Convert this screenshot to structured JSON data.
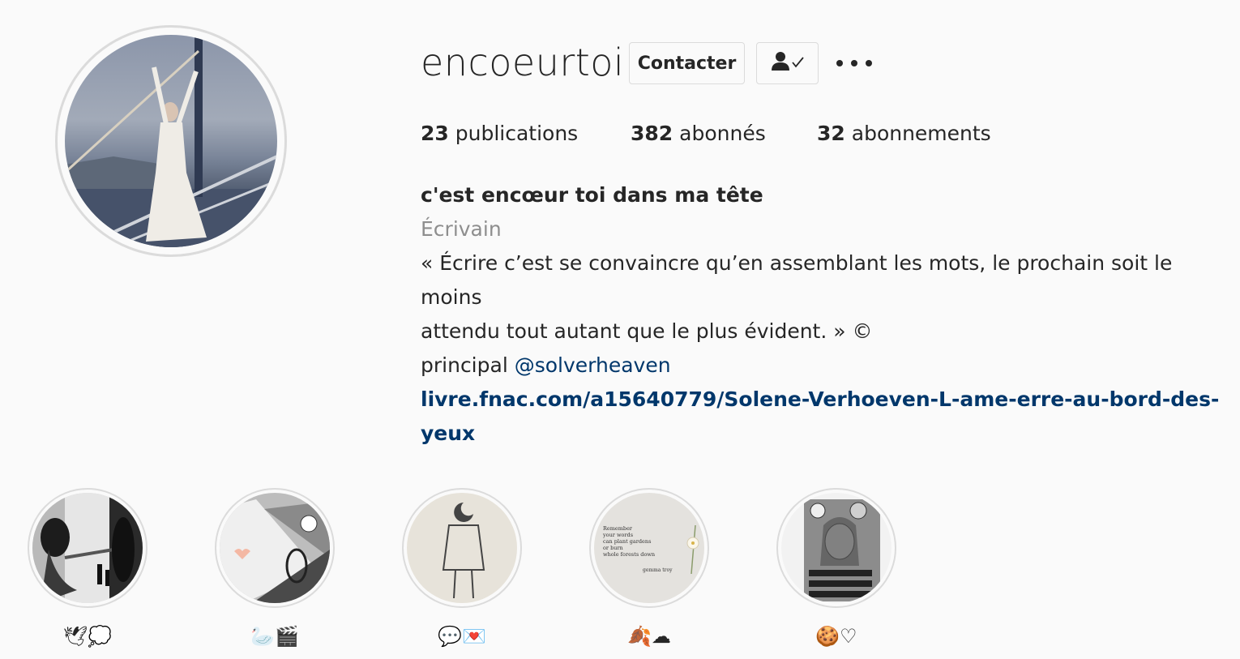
{
  "profile": {
    "username": "encoeurtoi",
    "contact_label": "Contacter",
    "icons": {
      "follow": "person-check-icon",
      "more": "more-dots-icon"
    }
  },
  "stats": {
    "posts_count": "23",
    "posts_label": "publications",
    "followers_count": "382",
    "followers_label": "abonnés",
    "following_count": "32",
    "following_label": "abonnements"
  },
  "bio": {
    "name": "c'est encœur toi dans ma tête",
    "category": "Écrivain",
    "text_line1": "« Écrire c’est se convaincre qu’en assemblant les mots, le prochain soit le moins",
    "text_line2": "attendu tout autant que le plus évident. » ©",
    "principal_prefix": "principal",
    "mention": "@solverheaven",
    "link": "livre.fnac.com/a15640779/Solene-Verhoeven-L-ame-erre-au-bord-des-yeux"
  },
  "highlights": [
    {
      "label": "🕊💭"
    },
    {
      "label": "🦢🎬"
    },
    {
      "label": "💬💌"
    },
    {
      "label": "🍂☁"
    },
    {
      "label": "🍪♡"
    }
  ],
  "highlight_4_text": [
    "Remember",
    "your words",
    "can plant gardens",
    "or burn",
    "whole forests down",
    "gemma troy"
  ],
  "colors": {
    "link": "#00376b",
    "muted": "#8e8e8e",
    "border": "#dbdbdb",
    "background": "#fafafa"
  }
}
